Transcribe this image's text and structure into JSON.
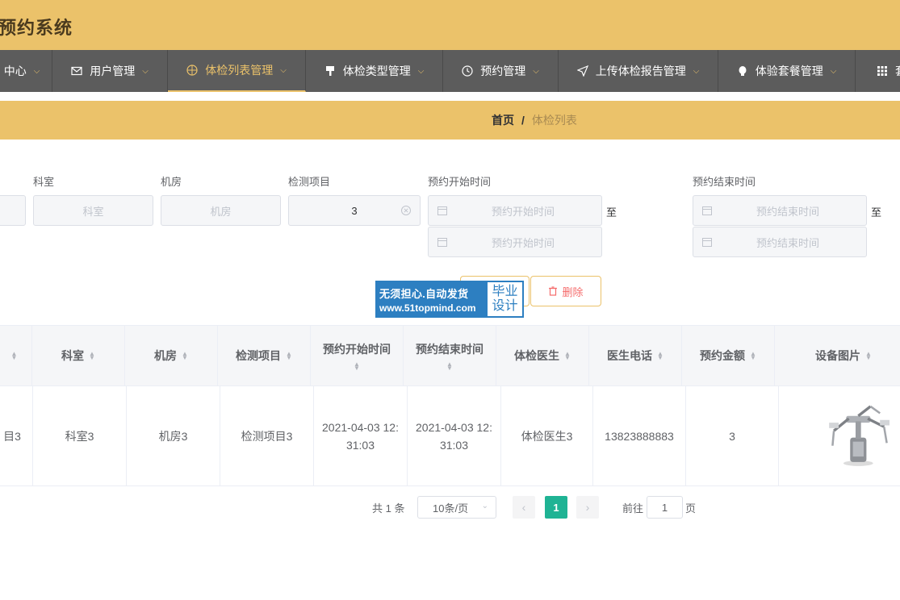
{
  "app": {
    "title": "预约系统"
  },
  "nav": {
    "items": [
      {
        "label": "中心"
      },
      {
        "label": "用户管理"
      },
      {
        "label": "体检列表管理"
      },
      {
        "label": "体检类型管理"
      },
      {
        "label": "预约管理"
      },
      {
        "label": "上传体检报告管理"
      },
      {
        "label": "体验套餐管理"
      },
      {
        "label": "套"
      }
    ],
    "active_index": 2,
    "accent": "#ebc26a"
  },
  "breadcrumb": {
    "home": "首页",
    "separator": "/",
    "current": "体检列表"
  },
  "search": {
    "labels": {
      "keshi": "科室",
      "jifang": "机房",
      "jiance": "检测项目",
      "start": "预约开始时间",
      "end": "预约结束时间"
    },
    "placeholders": {
      "keshi": "科室",
      "jifang": "机房",
      "start": "预约开始时间",
      "end": "预约结束时间"
    },
    "values": {
      "jiance": "3"
    },
    "range_separator": "至"
  },
  "actions": {
    "delete_label": "删除"
  },
  "watermark": {
    "line1": "无须担心.自动发货",
    "line2": "www.51topmind.com",
    "badge1": "毕业",
    "badge2": "设计"
  },
  "table": {
    "headers": [
      "科室",
      "机房",
      "检测项目",
      "预约开始时间",
      "预约结束时间",
      "体检医生",
      "医生电话",
      "预约金额",
      "设备图片"
    ],
    "rows": [
      {
        "first_partial": "目3",
        "keshi": "科室3",
        "jifang": "机房3",
        "jiance": "检测项目3",
        "start": "2021-04-03 12:31:03",
        "end": "2021-04-03 12:31:03",
        "doctor": "体检医生3",
        "phone": "13823888883",
        "amount": "3"
      }
    ]
  },
  "pagination": {
    "total_text": "共 1 条",
    "page_size": "10条/页",
    "current_page": "1",
    "goto_label": "前往",
    "goto_value": "1",
    "page_suffix": "页",
    "accent": "#1fb394"
  }
}
